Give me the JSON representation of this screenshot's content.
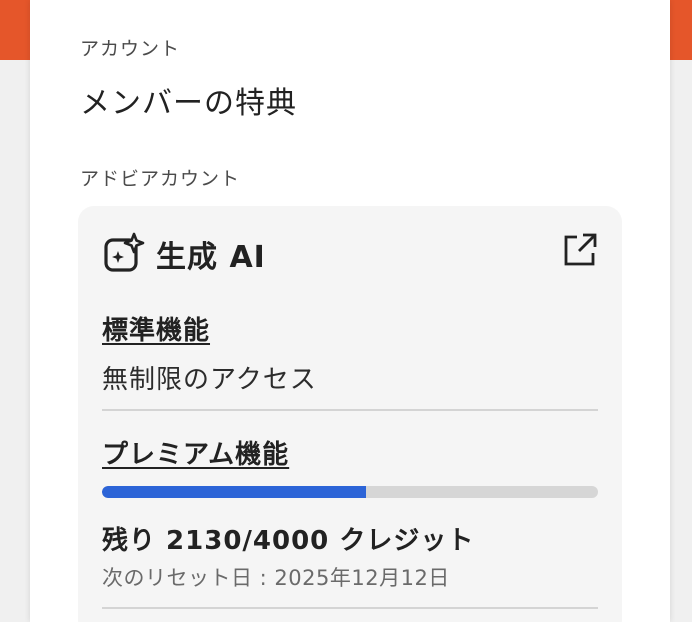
{
  "colors": {
    "accent": "#e5562a",
    "progress_fill": "#2c64d7",
    "progress_track": "#d6d6d6",
    "card_bg": "#f5f5f5"
  },
  "header": {
    "breadcrumb": "アカウント",
    "title": "メンバーの特典"
  },
  "section": {
    "label": "アドビアカウント"
  },
  "card": {
    "icon": "generative-ai-sparkle-icon",
    "title": "生成 AI",
    "external_icon": "external-link-icon",
    "standard": {
      "heading": "標準機能",
      "description": "無制限のアクセス"
    },
    "premium": {
      "heading": "プレミアム機能",
      "credits_used_fraction": 0.5325,
      "credits_text": "残り 2130/4000 クレジット",
      "reset_text": "次のリセット日 : 2025年12月12日"
    }
  }
}
